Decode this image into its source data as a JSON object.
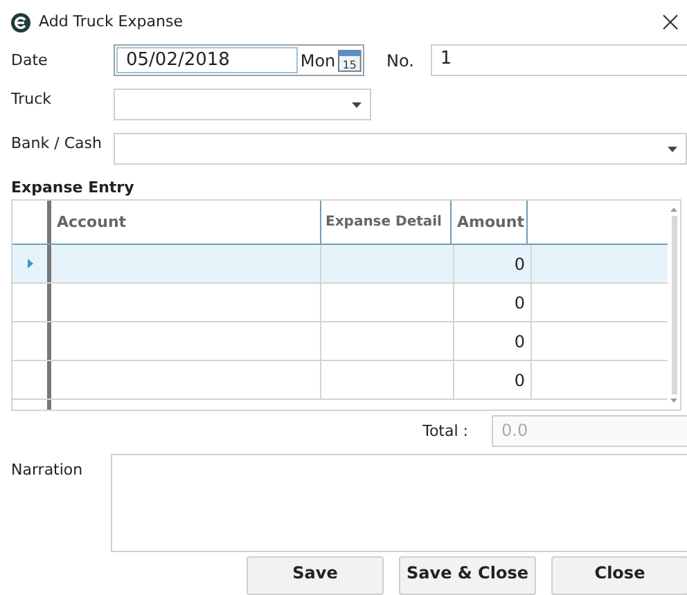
{
  "window": {
    "title": "Add Truck Expanse"
  },
  "date": {
    "label": "Date",
    "value": "05/02/2018",
    "weekday": "Mon",
    "calendar_day": "15"
  },
  "number": {
    "label": "No.",
    "value": "1"
  },
  "truck": {
    "label": "Truck"
  },
  "bank_cash": {
    "label": "Bank / Cash"
  },
  "entry": {
    "title": "Expanse Entry",
    "columns": [
      "Account",
      "Expanse Detail",
      "Amount"
    ],
    "rows": [
      {
        "selected": true,
        "amount": "0"
      },
      {
        "selected": false,
        "amount": "0"
      },
      {
        "selected": false,
        "amount": "0"
      },
      {
        "selected": false,
        "amount": "0"
      }
    ]
  },
  "total": {
    "label": "Total :",
    "value": "0.0",
    "disabled": true
  },
  "narration": {
    "label": "Narration"
  },
  "buttons": [
    "Save",
    "Save & Close",
    "Close"
  ]
}
